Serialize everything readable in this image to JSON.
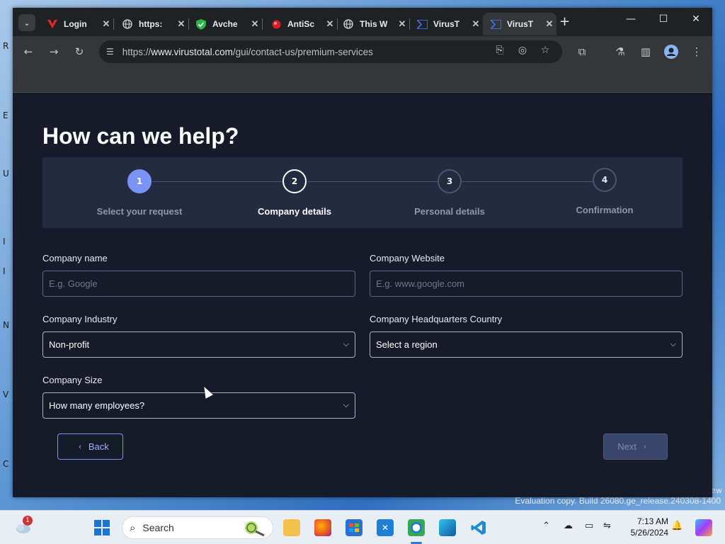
{
  "tabs": [
    {
      "title": "Login",
      "favicon": "red-swoosh-icon"
    },
    {
      "title": "https:",
      "favicon": "globe-icon"
    },
    {
      "title": "Avche",
      "favicon": "green-shield-icon"
    },
    {
      "title": "AntiSc",
      "favicon": "red-dot-icon"
    },
    {
      "title": "This W",
      "favicon": "globe-icon"
    },
    {
      "title": "VirusT",
      "favicon": "virustotal-icon"
    },
    {
      "title": "VirusT",
      "favicon": "virustotal-icon",
      "active": true
    }
  ],
  "address_bar": {
    "scheme": "https://",
    "host": "www.virustotal.com",
    "path": "/gui/contact-us/premium-services"
  },
  "page": {
    "heading": "How can we help?",
    "steps": [
      {
        "number": "1",
        "label": "Select your request",
        "state": "done"
      },
      {
        "number": "2",
        "label": "Company details",
        "state": "current"
      },
      {
        "number": "3",
        "label": "Personal details",
        "state": "pending"
      },
      {
        "number": "4",
        "label": "Confirmation",
        "state": "pending"
      }
    ],
    "form": {
      "company_name": {
        "label": "Company name",
        "placeholder": "E.g. Google",
        "value": ""
      },
      "company_website": {
        "label": "Company Website",
        "placeholder": "E.g. www.google.com",
        "value": ""
      },
      "company_industry": {
        "label": "Company Industry",
        "value": "Non-profit"
      },
      "company_hq_country": {
        "label": "Company Headquarters Country",
        "value": "Select a region"
      },
      "company_size": {
        "label": "Company Size",
        "value": "How many employees?"
      }
    },
    "back_label": "Back",
    "next_label": "Next"
  },
  "taskbar": {
    "search_placeholder": "Search",
    "notification_count": "1",
    "time": "7:13 AM",
    "date": "5/26/2024"
  },
  "desktop": {
    "watermark": "Evaluation copy. Build 26080.ge_release.240308-1400",
    "watermark_small": "ew",
    "fragments": [
      "R",
      "E",
      "U",
      "I",
      "I",
      "N",
      "V",
      "C"
    ]
  },
  "colors": {
    "page_bg": "#171a28",
    "stepper_bg": "#232b40",
    "accent": "#7b93f5",
    "next_disabled": "#39466b"
  }
}
